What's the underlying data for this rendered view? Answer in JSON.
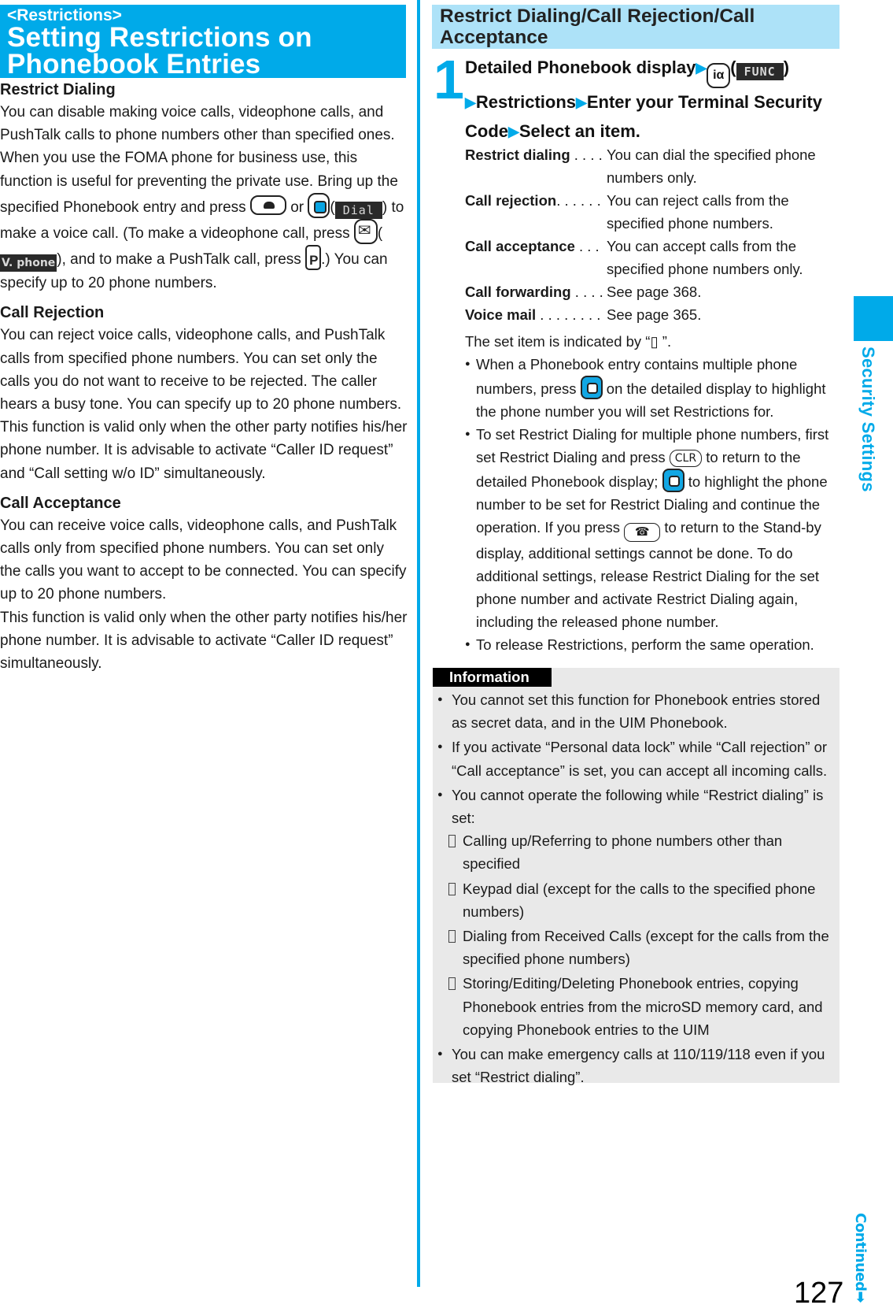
{
  "left": {
    "header_small": "<Restrictions>",
    "header_line1": "Setting Restrictions on",
    "header_line2": "Phonebook Entries",
    "sections": [
      {
        "title": "Restrict Dialing",
        "p1": "You can disable making voice calls, videophone calls, and PushTalk calls to phone numbers other than specified ones. When you use the FOMA phone for business use, this function is useful for preventing the private use. Bring up the specified Phonebook entry and press",
        "p1_or": "or",
        "p1_dial": "Dial",
        "p1_mid": "to make a voice call. (To make a videophone call, press",
        "p1_vphone": "V. phone",
        "p1_mid2": "), and to make a PushTalk call, press",
        "p1_end": ".) You can specify up to 20 phone numbers."
      },
      {
        "title": "Call Rejection",
        "p1": "You can reject voice calls, videophone calls, and PushTalk calls from specified phone numbers. You can set only the calls you do not want to receive to be rejected. The caller hears a busy tone. You can specify up to 20 phone numbers.",
        "p2": "This function is valid only when the other party notifies his/her phone number. It is advisable to activate “Caller ID request” and “Call setting w/o ID” simultaneously."
      },
      {
        "title": "Call Acceptance",
        "p1": "You can receive voice calls, videophone calls, and PushTalk calls only from specified phone numbers. You can set only the calls you want to accept to be connected. You can specify up to 20 phone numbers.",
        "p2": "This function is valid only when the other party notifies his/her phone number. It is advisable to activate “Caller ID request” simultaneously."
      }
    ]
  },
  "right": {
    "header": "Restrict Dialing/Call Rejection/Call Acceptance",
    "step_number": "1",
    "step": {
      "part1": "Detailed Phonebook display",
      "func": "FUNC",
      "part2": "Restrictions",
      "part3": "Enter your Terminal Security Code",
      "part4": "Select an item."
    },
    "definitions": [
      {
        "term": "Restrict dialing",
        "dots": " . . . .",
        "desc": "You can dial the specified phone numbers only."
      },
      {
        "term": "Call rejection",
        "dots": ". . . . . .",
        "desc": "You can reject calls from the specified phone numbers."
      },
      {
        "term": "Call acceptance",
        "dots": "  . . .",
        "desc": "You can accept calls from the specified phone numbers only."
      },
      {
        "term": "Call forwarding",
        "dots": " . . . .",
        "desc": "See page 368."
      },
      {
        "term": "Voice mail",
        "dots": " . . . . . . . .",
        "desc": "See page 365."
      }
    ],
    "set_item_note": "The set item is indicated by “▯ ”.",
    "bullets": {
      "b1_a": "When a Phonebook entry contains multiple phone numbers, press",
      "b1_b": "on the detailed display to highlight the phone number you will set Restrictions for.",
      "b2_a": "To set Restrict Dialing for multiple phone numbers, first set Restrict Dialing and press",
      "b2_clr": "CLR",
      "b2_b": "to return to the detailed Phonebook display;",
      "b2_c": "to highlight the phone number to be set for Restrict Dialing and continue the operation. If you press",
      "b2_d": "to return to the Stand-by display, additional settings cannot be done. To do additional settings, release Restrict Dialing for the set phone number and activate Restrict Dialing again, including the released phone number.",
      "b3": "To release Restrictions, perform the same operation."
    },
    "info": {
      "label": "Information",
      "items": [
        "You cannot set this function for Phonebook entries stored as secret data, and in the UIM Phonebook.",
        "If you activate “Personal data lock” while “Call rejection” or “Call acceptance” is set, you can accept all incoming calls.",
        "You cannot operate the following while “Restrict dialing” is set:"
      ],
      "subitems": [
        "Calling up/Referring to phone numbers other than specified",
        "Keypad dial (except for the calls to the specified phone numbers)",
        "Dialing from Received Calls (except for the calls from the specified phone numbers)",
        "Storing/Editing/Deleting Phonebook entries, copying Phonebook entries from the microSD memory card, and copying Phonebook entries to the UIM"
      ],
      "last_item": "You can make emergency calls at 110/119/118 even if you set “Restrict dialing”."
    }
  },
  "side_tab": "Security Settings",
  "continued": "Continued",
  "page_number": "127",
  "colors": {
    "accent": "#00aae9",
    "header_light": "#ade2f8",
    "info_bg": "#e9e9e9"
  }
}
